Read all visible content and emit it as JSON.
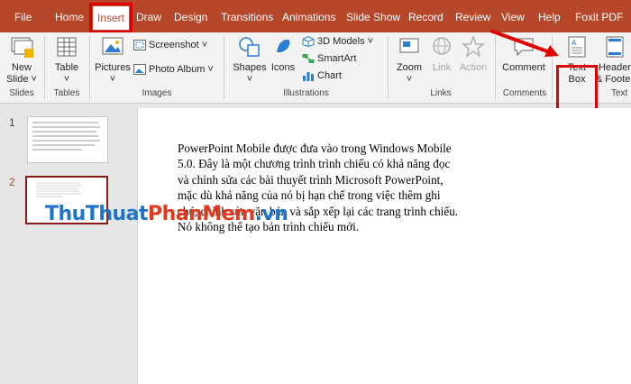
{
  "tabs": [
    "File",
    "Home",
    "Insert",
    "Draw",
    "Design",
    "Transitions",
    "Animations",
    "Slide Show",
    "Record",
    "Review",
    "View",
    "Help",
    "Foxit PDF"
  ],
  "active_tab": "Insert",
  "ribbon": {
    "new_slide": [
      "New",
      "Slide ˅"
    ],
    "table": [
      "Table",
      "˅"
    ],
    "pictures": [
      "Pictures",
      "˅"
    ],
    "screenshot": "Screenshot ˅",
    "photo_album": "Photo Album ˅",
    "shapes": [
      "Shapes",
      "˅"
    ],
    "icons": "Icons",
    "models_3d": "3D Models ˅",
    "smartart": "SmartArt",
    "chart": "Chart",
    "zoom": [
      "Zoom",
      "˅"
    ],
    "link": "Link",
    "action": "Action",
    "comment": "Comment",
    "text_box": [
      "Text",
      "Box"
    ],
    "header_footer": [
      "Header",
      "& Footer"
    ],
    "groups": {
      "slides": "Slides",
      "tables": "Tables",
      "images": "Images",
      "illustrations": "Illustrations",
      "links": "Links",
      "comments": "Comments",
      "text": "Text"
    }
  },
  "slides": [
    {
      "number": "1"
    },
    {
      "number": "2"
    }
  ],
  "slide_text": [
    "PowerPoint Mobile được đưa vào trong Windows Mobile",
    "5.0. Đây là một chương trình trình chiếu có khả năng đọc",
    "và chỉnh sửa các bài thuyết trình Microsoft PowerPoint,",
    "mặc dù khả năng của nó bị hạn chế trong việc thêm ghi",
    "chú, chỉnh sửa văn bản và sắp xếp lại các trang trình chiếu.",
    "Nó không thể tạo bản trình chiếu mới."
  ],
  "watermark": {
    "part1": "ThuThuat",
    "part2": "PhanMem",
    "part3": ".vn"
  },
  "colors": {
    "tabbar": "#b7472a",
    "highlight": "#e00000",
    "accent_icon": "#2b7cd3"
  }
}
